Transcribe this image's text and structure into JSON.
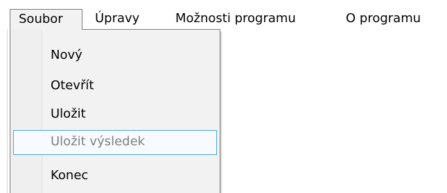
{
  "menubar": {
    "items": [
      {
        "label": "Soubor"
      },
      {
        "label": "Úpravy"
      },
      {
        "label": "Možnosti programu"
      },
      {
        "label": "O programu"
      }
    ]
  },
  "dropdown": {
    "items": [
      {
        "label": "Nový",
        "enabled": true
      },
      {
        "label": "Otevřít",
        "enabled": true
      },
      {
        "label": "Uložit",
        "enabled": true
      },
      {
        "label": "Uložit výsledek",
        "enabled": false,
        "highlighted": true
      },
      {
        "label": "Konec",
        "enabled": true
      }
    ]
  },
  "colors": {
    "menu_bg": "#f2f2f2",
    "border": "#7a7a7a",
    "highlight_border": "#4aa3df",
    "disabled_text": "#7f7f7f"
  }
}
